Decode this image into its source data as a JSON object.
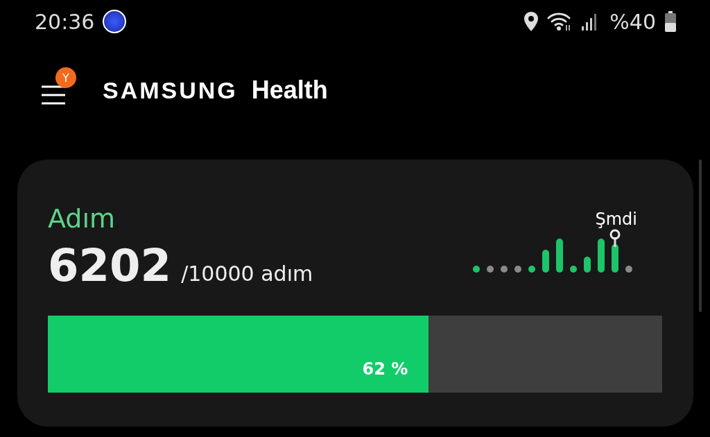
{
  "status_bar": {
    "time": "20:36",
    "battery_text": "%40"
  },
  "header": {
    "badge": "Y",
    "brand": "SAMSUNG",
    "app": "Health"
  },
  "steps_card": {
    "title": "Adım",
    "count": "6202",
    "goal": "/10000 adım",
    "now_label": "Şmdi",
    "progress": {
      "level": 0.62,
      "label": "62 %"
    }
  }
}
